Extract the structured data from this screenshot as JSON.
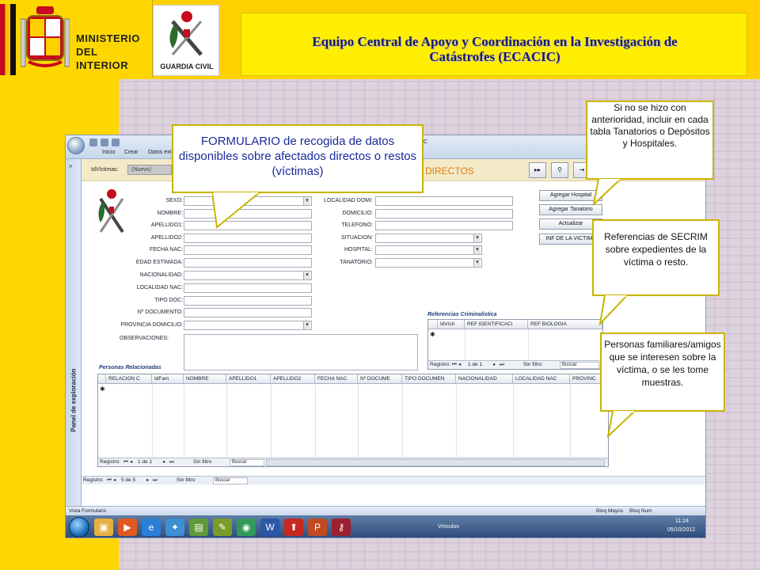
{
  "slide": {
    "ministry_line1": "MINISTERIO",
    "ministry_line2": "DEL INTERIOR",
    "guardia_civil": "GUARDIA CIVIL",
    "title_line1": "Equipo Central de Apoyo y Coordinación en la Investigación de",
    "title_line2": "Catástrofes (ECACIC)"
  },
  "callouts": {
    "main": "FORMULARIO de recogida de datos disponibles sobre afectados directos o restos (víctimas)",
    "tanatorios": "Si no se hizo con anterioridad, incluir en cada tabla Tanatorios o Depósitos y Hospitales.",
    "secrim": "Referencias de SECRIM sobre expedientes de la víctima o resto.",
    "personas": "Personas familiares/amigos que se interesen sobre la víctima, o se les tome muestras."
  },
  "app": {
    "tabs": [
      "Inicio",
      "Crear",
      "Datos exte"
    ],
    "window_title_fragment": "C",
    "nav_chevron": "»",
    "nav_label": "Panel de exploración",
    "idvictimas_label": "IdVíctimas:",
    "idvictimas_value": "(Nuevo)",
    "form_heading": "DIRECTOS",
    "header_buttons": [
      "▸▸",
      "⚲",
      "⇥"
    ]
  },
  "form": {
    "left_fields": [
      {
        "label": "SEXO:",
        "dropdown": true
      },
      {
        "label": "NOMBRE:",
        "dropdown": false
      },
      {
        "label": "APELLIDO1:",
        "dropdown": false
      },
      {
        "label": "APELLIDO2:",
        "dropdown": false
      },
      {
        "label": "FECHA NAC:",
        "dropdown": false
      },
      {
        "label": "EDAD ESTIMADA:",
        "dropdown": false
      },
      {
        "label": "NACIONALIDAD:",
        "dropdown": true
      },
      {
        "label": "LOCALIDAD NAC:",
        "dropdown": false
      },
      {
        "label": "TIPO DOC:",
        "dropdown": false
      },
      {
        "label": "Nº DOCUMENTO:",
        "dropdown": false
      },
      {
        "label": "PROVINCIA DOMICILIO:",
        "dropdown": true
      },
      {
        "label": "OBSERVACIONES:",
        "dropdown": false
      }
    ],
    "right_fields": [
      {
        "label": "LOCALIDAD DOMI:",
        "dropdown": false
      },
      {
        "label": "DOMICILIO:",
        "dropdown": false
      },
      {
        "label": "TELEFONO:",
        "dropdown": false
      },
      {
        "label": "SITUACION:",
        "dropdown": true
      },
      {
        "label": "HOSPITAL:",
        "dropdown": true
      },
      {
        "label": "TANATORIO:",
        "dropdown": true
      }
    ],
    "buttons": [
      "Agregar Hospital",
      "Agregar Tanatorio",
      "Actualizar",
      "INF DE LA VICTIMA"
    ]
  },
  "referencias": {
    "title": "Referencias Criminalística",
    "columns": [
      "IdVícti",
      "REF IDENTIFICACI",
      "REF BIOLOGIA"
    ],
    "new_row_marker": "✱",
    "record_label": "Registro:",
    "record_nav_first": "⏮",
    "record_nav_prev": "◂",
    "record_value": "1 de 1",
    "record_nav_next": "▸",
    "record_nav_last": "⏭",
    "filter": "Sin filtro",
    "search": "Buscar"
  },
  "personas": {
    "title": "Personas Relacionadas",
    "columns": [
      "RELACION C",
      "IdFam",
      "NOMBRE",
      "APELLIDO1",
      "APELLIDO2",
      "FECHA NAC",
      "Nº DOCUME",
      "TIPO DOCUMEN",
      "NACIONALIDAD",
      "LOCALIDAD NAC",
      "PROVINC"
    ],
    "new_row_marker": "✱",
    "record_label": "Registro:",
    "record_nav_first": "⏮",
    "record_nav_prev": "◂",
    "record_value": "1 de 1",
    "record_nav_next": "▸",
    "record_nav_last": "⏭",
    "filter": "Sin filtro",
    "search": "Buscar"
  },
  "main_record": {
    "label": "Registro:",
    "nav_first": "⏮",
    "nav_prev": "◂",
    "value": "5 de 5",
    "nav_next": "▸",
    "nav_last": "⏭",
    "filter": "Sin filtro",
    "search": "Buscar"
  },
  "statusbar": {
    "view": "Vista Formulario",
    "caps": "Bloq Mayús",
    "num": "Bloq Num"
  },
  "taskbar": {
    "vinculos": "Vínculos",
    "time": "11:24",
    "date": "05/10/2012"
  }
}
